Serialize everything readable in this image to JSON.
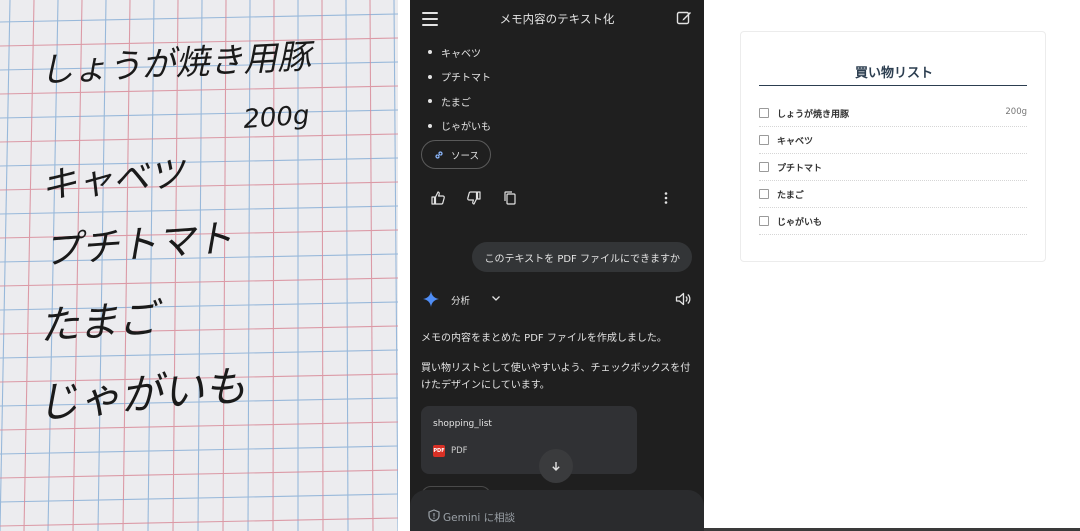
{
  "photo": {
    "memo_lines": [
      "しょうが焼き用豚",
      "200g",
      "キャベツ",
      "プチトマト",
      "たまご",
      "じゃがいも"
    ],
    "paper_color": "#ececef",
    "grid_colors": [
      "#8fb3d8",
      "#d98c9a"
    ],
    "ink_color": "#1a1a1a"
  },
  "chat": {
    "header": {
      "title": "メモ内容のテキスト化",
      "menu_icon": "hamburger-menu-icon",
      "new_chat_icon": "edit-icon"
    },
    "bullet_items": [
      "キャベツ",
      "プチトマト",
      "たまご",
      "じゃがいも"
    ],
    "source_chip": "ソース",
    "action_icons": [
      "thumb-up-icon",
      "thumb-down-icon",
      "copy-icon",
      "more-vert-icon"
    ],
    "user_message": "このテキストを PDF ファイルにできますか",
    "model_mode": "分析",
    "reply_paragraph_1": "メモの内容をまとめた PDF ファイルを作成しました。",
    "reply_paragraph_2": "買い物リストとして使いやすいよう、チェックボックスを付けたデザインにしています。",
    "file": {
      "name": "shopping_list",
      "badge": "PDF",
      "type": "PDF"
    },
    "composer_placeholder": "Gemini に相談",
    "colors": {
      "background": "#1f1f1f",
      "bubble": "#333537",
      "card": "#303134",
      "text": "#e3e3e3",
      "pdf_red": "#d93025",
      "spark_blue": "#4f8df5"
    }
  },
  "pdf_preview": {
    "title": "買い物リスト",
    "items": [
      {
        "name": "しょうが焼き用豚",
        "qty": "200g"
      },
      {
        "name": "キャベツ",
        "qty": ""
      },
      {
        "name": "プチトマト",
        "qty": ""
      },
      {
        "name": "たまご",
        "qty": ""
      },
      {
        "name": "じゃがいも",
        "qty": ""
      }
    ],
    "title_color": "#2c3e50"
  }
}
